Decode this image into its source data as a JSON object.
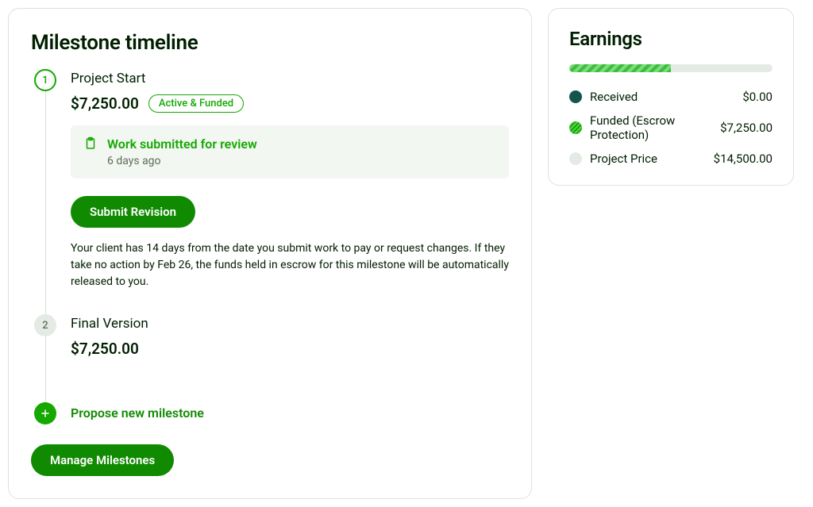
{
  "timeline": {
    "title": "Milestone timeline",
    "milestones": [
      {
        "number": "1",
        "title": "Project Start",
        "amount": "$7,250.00",
        "chip": "Active & Funded",
        "status": {
          "title": "Work submitted for review",
          "sub": "6 days ago"
        },
        "submit_label": "Submit Revision",
        "info": "Your client has 14 days from the date you submit work to pay or request changes. If they take no action by Feb 26, the funds held in escrow for this milestone will be automatically released to you."
      },
      {
        "number": "2",
        "title": "Final Version",
        "amount": "$7,250.00"
      }
    ],
    "propose_label": "Propose new milestone",
    "manage_label": "Manage Milestones"
  },
  "earnings": {
    "title": "Earnings",
    "progress_percent": 50,
    "rows": [
      {
        "label": "Received",
        "value": "$0.00"
      },
      {
        "label": "Funded (Escrow Protection)",
        "value": "$7,250.00"
      },
      {
        "label": "Project Price",
        "value": "$14,500.00"
      }
    ]
  }
}
